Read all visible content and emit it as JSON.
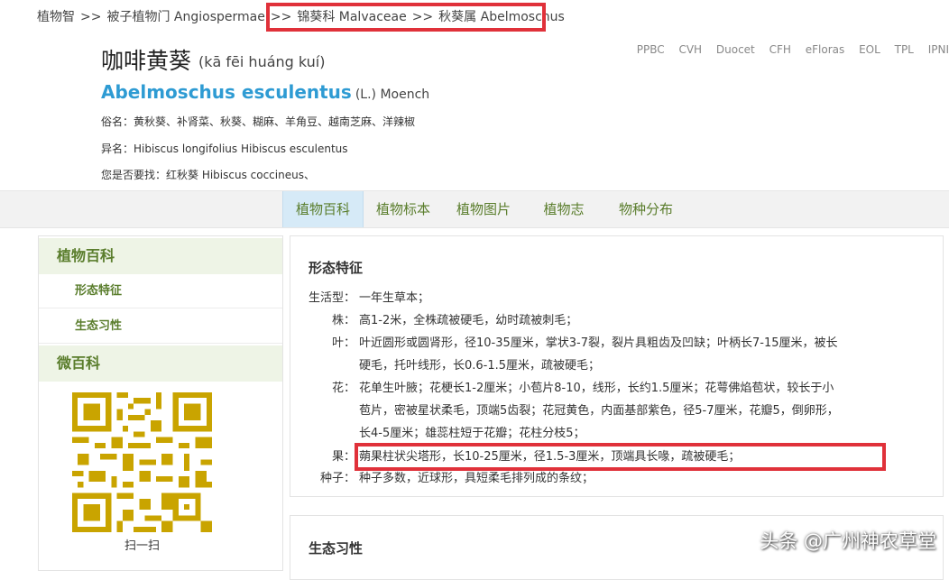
{
  "breadcrumb": {
    "items": [
      "植物智",
      "被子植物门 Angiospermae",
      "锦葵科 Malvaceae",
      "秋葵属 Abelmoschus"
    ],
    "separator": ">>"
  },
  "header": {
    "chinese_name": "咖啡黄葵",
    "pinyin": "(kā fēi huáng kuí)",
    "scientific_name": "Abelmoschus esculentus",
    "author": "(L.) Moench",
    "common_names": "俗名：黄秋葵、补肾菜、秋葵、糊麻、羊角豆、越南芝麻、洋辣椒",
    "synonyms": "异名：Hibiscus longifolius  Hibiscus esculentus",
    "suggestion": "您是否要找：红秋葵 Hibiscus coccineus、"
  },
  "external_links": [
    "PPBC",
    "CVH",
    "Duocet",
    "CFH",
    "eFloras",
    "EOL",
    "TPL",
    "IPNI"
  ],
  "tabs": [
    {
      "label": "植物百科",
      "active": true
    },
    {
      "label": "植物标本",
      "active": false
    },
    {
      "label": "植物图片",
      "active": false
    },
    {
      "label": "植物志",
      "active": false
    },
    {
      "label": "物种分布",
      "active": false
    }
  ],
  "sidebar": {
    "section1": "植物百科",
    "items": [
      "形态特征",
      "生态习性"
    ],
    "section2": "微百科",
    "qr_caption": "扫一扫"
  },
  "morphology": {
    "title": "形态特征",
    "rows": [
      {
        "label": "生活型：",
        "text": "一年生草本；"
      },
      {
        "label": "株：",
        "text": "高1-2米，全株疏被硬毛，幼时疏被刺毛；"
      },
      {
        "label": "叶：",
        "lines": [
          "叶近圆形或圆肾形，径10-35厘米，掌状3-7裂，裂片具粗齿及凹缺；叶柄长7-15厘米，被长",
          "硬毛，托叶线形，长0.6-1.5厘米，疏被硬毛；"
        ]
      },
      {
        "label": "花：",
        "lines": [
          "花单生叶腋；花梗长1-2厘米；小苞片8-10，线形，长约1.5厘米；花萼佛焰苞状，较长于小",
          "苞片，密被星状柔毛，顶端5齿裂；花冠黄色，内面基部紫色，径5-7厘米，花瓣5，倒卵形，",
          "长4-5厘米；雄蕊柱短于花瓣；花柱分枝5；"
        ]
      },
      {
        "label": "果：",
        "text": "蒴果柱状尖塔形，长10-25厘米，径1.5-3厘米，顶端具长喙，疏被硬毛；"
      },
      {
        "label": "种子：",
        "text": "种子多数，近球形，具短柔毛排列成的条纹；"
      }
    ]
  },
  "ecology": {
    "title": "生态习性"
  },
  "watermark": "头条 @广州神农草堂",
  "colors": {
    "link_blue": "#2e9bd3",
    "nav_green": "#5a7d2c",
    "highlight_red": "#e0313a",
    "tab_active_bg": "#d6eaf7",
    "sidebar_head_bg": "#eef4e6",
    "qr_gold": "#c9a400"
  }
}
